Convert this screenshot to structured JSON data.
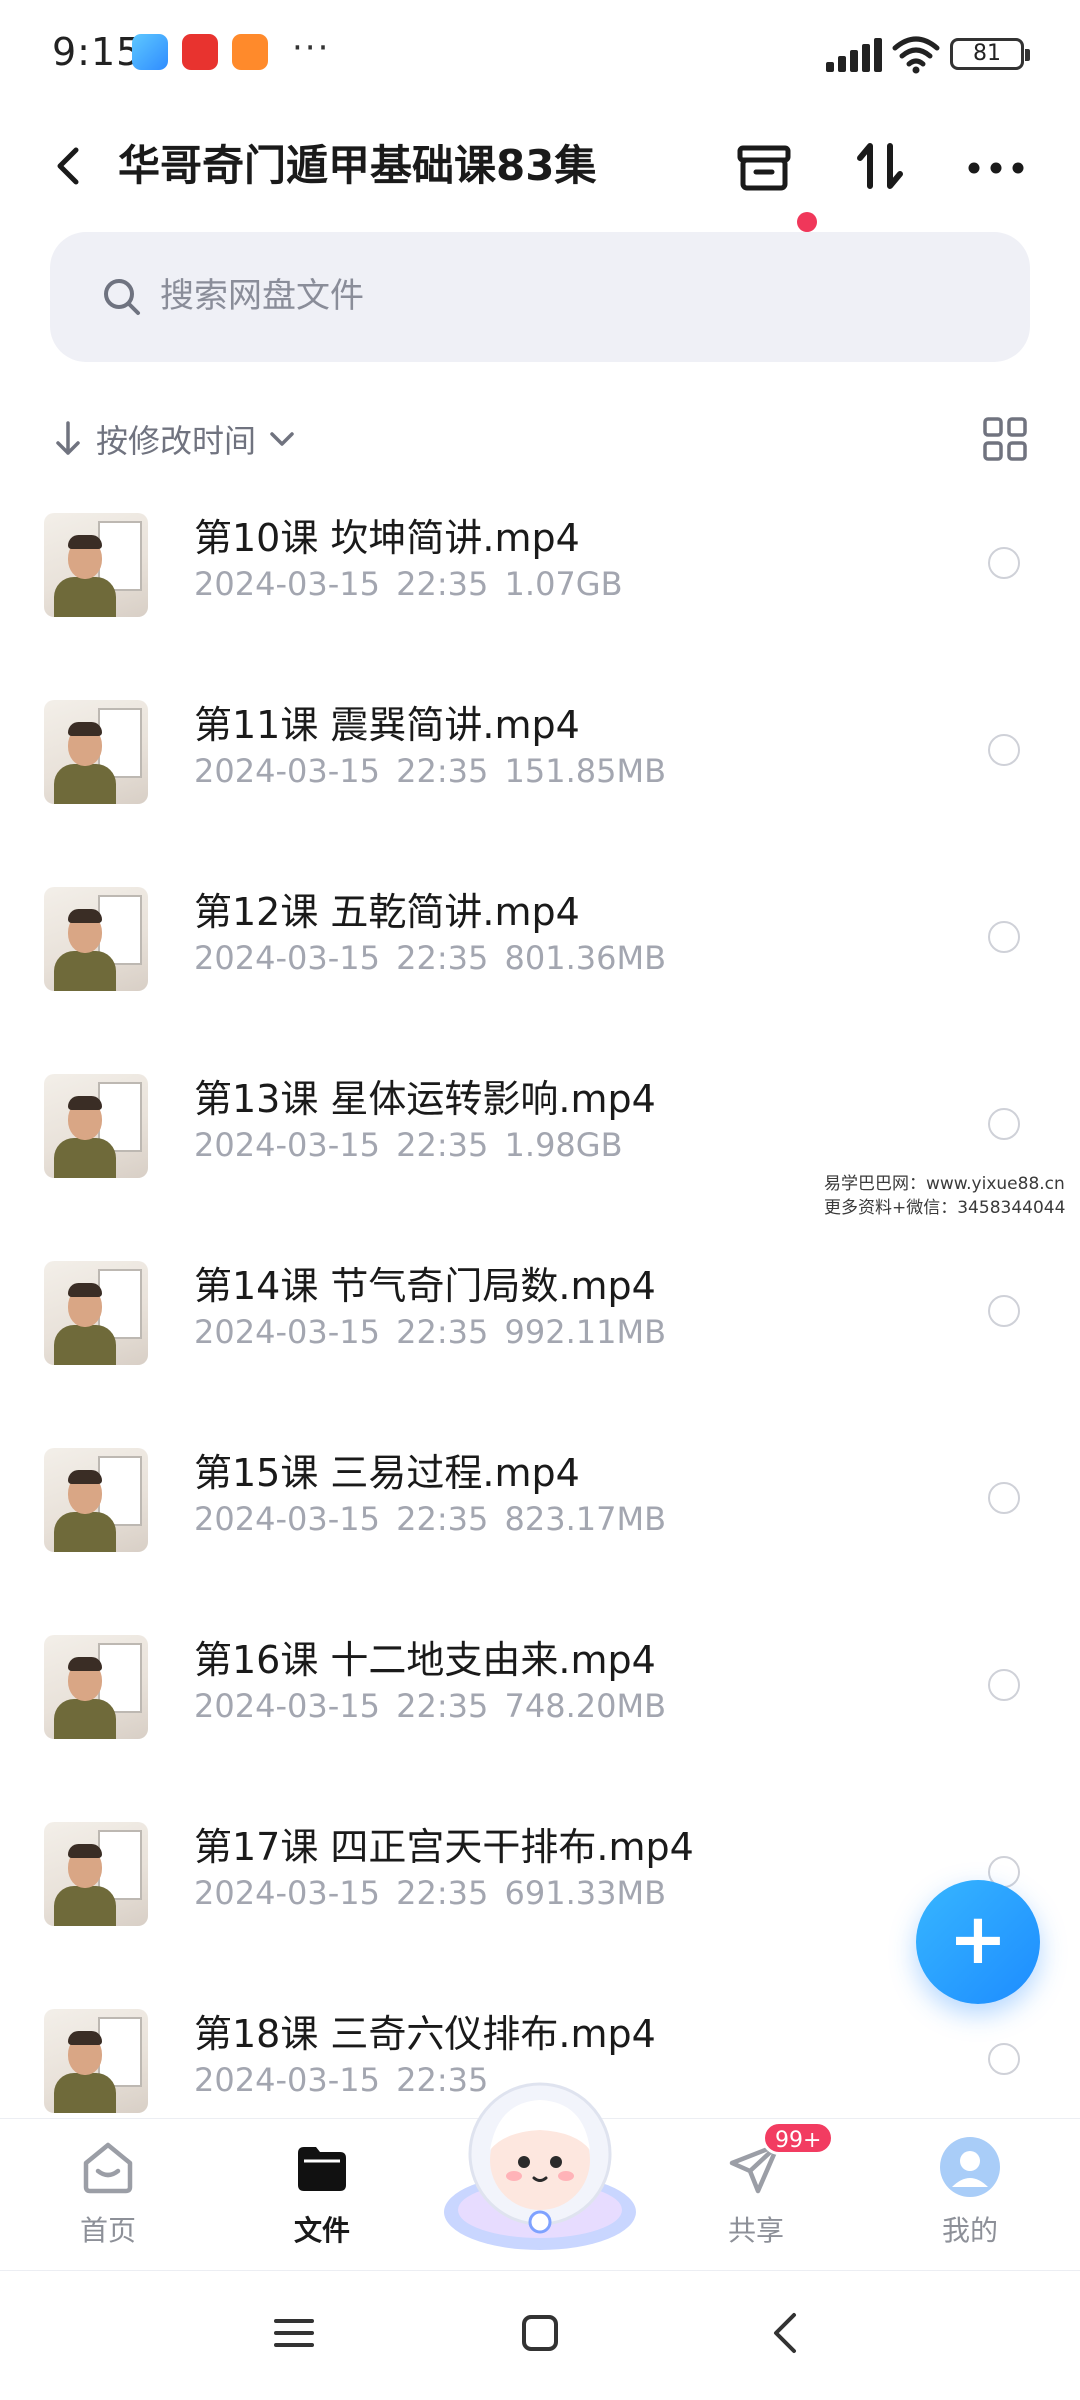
{
  "status_bar": {
    "time": "9:15",
    "more": "···",
    "battery": "81"
  },
  "header": {
    "title": "华哥奇门遁甲基础课83集"
  },
  "search": {
    "placeholder": "搜索网盘文件"
  },
  "sort": {
    "label": "按修改时间"
  },
  "files": [
    {
      "name": "第10课 坎坤简讲.mp4",
      "date": "2024-03-15",
      "time": "22:35",
      "size": "1.07GB"
    },
    {
      "name": "第11课 震巽简讲.mp4",
      "date": "2024-03-15",
      "time": "22:35",
      "size": "151.85MB"
    },
    {
      "name": "第12课 五乾简讲.mp4",
      "date": "2024-03-15",
      "time": "22:35",
      "size": "801.36MB"
    },
    {
      "name": "第13课 星体运转影响.mp4",
      "date": "2024-03-15",
      "time": "22:35",
      "size": "1.98GB"
    },
    {
      "name": "第14课 节气奇门局数.mp4",
      "date": "2024-03-15",
      "time": "22:35",
      "size": "992.11MB"
    },
    {
      "name": "第15课 三易过程.mp4",
      "date": "2024-03-15",
      "time": "22:35",
      "size": "823.17MB"
    },
    {
      "name": "第16课 十二地支由来.mp4",
      "date": "2024-03-15",
      "time": "22:35",
      "size": "748.20MB"
    },
    {
      "name": "第17课 四正宫天干排布.mp4",
      "date": "2024-03-15",
      "time": "22:35",
      "size": "691.33MB"
    },
    {
      "name": "第18课 三奇六仪排布.mp4",
      "date": "2024-03-15",
      "time": "22:35",
      "size": ""
    }
  ],
  "watermark": {
    "line1": "易学巴巴网：www.yixue88.cn",
    "line2": "更多资料+微信：3458344044"
  },
  "fab": {
    "label": "+"
  },
  "nav": {
    "home": "首页",
    "files": "文件",
    "share": "共享",
    "share_badge": "99+",
    "me": "我的"
  },
  "colors": {
    "accent": "#2f96ff",
    "badge": "#f23c61",
    "meta_text": "#a3a6b0"
  }
}
